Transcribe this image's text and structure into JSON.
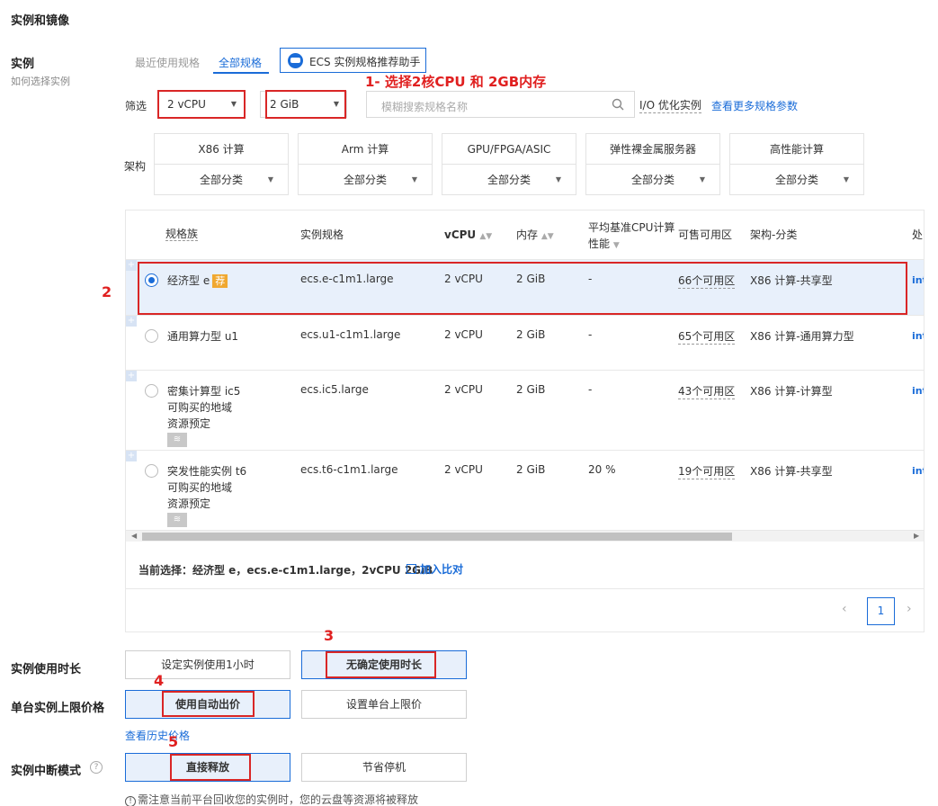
{
  "section_title": "实例和镜像",
  "instance": {
    "label": "实例",
    "help_link": "如何选择实例",
    "tabs": [
      "最近使用规格",
      "全部规格"
    ],
    "assistant_button": "ECS 实例规格推荐助手",
    "annotation_1": "1- 选择2核CPU 和 2GB内存",
    "filter_label": "筛选",
    "vcpu_select": "2 vCPU",
    "mem_select": "2 GiB",
    "search_placeholder": "模糊搜索规格名称",
    "io_optimized": "I/O 优化实例",
    "more_params": "查看更多规格参数",
    "arch_label": "架构",
    "arch_options": [
      {
        "name": "X86 计算",
        "value": "全部分类"
      },
      {
        "name": "Arm 计算",
        "value": "全部分类"
      },
      {
        "name": "GPU/FPGA/ASIC",
        "value": "全部分类"
      },
      {
        "name": "弹性裸金属服务器",
        "value": "全部分类"
      },
      {
        "name": "高性能计算",
        "value": "全部分类"
      }
    ]
  },
  "table": {
    "headers": [
      "规格族",
      "实例规格",
      "vCPU",
      "内存",
      "平均基准CPU计算性能",
      "可售可用区",
      "架构-分类",
      "处"
    ],
    "rows": [
      {
        "family": "经济型 e",
        "tag": "荐",
        "spec": "ecs.e-c1m1.large",
        "vcpu": "2 vCPU",
        "mem": "2 GiB",
        "perf": "-",
        "zones": "66个可用区",
        "arch": "X86 计算-共享型",
        "proc": "intel",
        "selected": true
      },
      {
        "family": "通用算力型 u1",
        "spec": "ecs.u1-c1m1.large",
        "vcpu": "2 vCPU",
        "mem": "2 GiB",
        "perf": "-",
        "zones": "65个可用区",
        "arch": "X86 计算-通用算力型",
        "proc": "intel"
      },
      {
        "family": "密集计算型 ic5",
        "link1": "可购买的地域",
        "link2": "资源预定",
        "spec": "ecs.ic5.large",
        "vcpu": "2 vCPU",
        "mem": "2 GiB",
        "perf": "-",
        "zones": "43个可用区",
        "arch": "X86 计算-计算型",
        "proc": "intel"
      },
      {
        "family": "突发性能实例 t6",
        "link1": "可购买的地域",
        "link2": "资源预定",
        "spec": "ecs.t6-c1m1.large",
        "vcpu": "2 vCPU",
        "mem": "2 GiB",
        "perf": "20 %",
        "zones": "19个可用区",
        "arch": "X86 计算-共享型",
        "proc": "intel"
      }
    ],
    "current_selection": "当前选择：经济型 e，ecs.e-c1m1.large，2vCPU 2GiB",
    "compare": "加入比对",
    "page": "1"
  },
  "annotations": {
    "a2": "2",
    "a3": "3",
    "a4": "4",
    "a5": "5"
  },
  "duration": {
    "label": "实例使用时长",
    "opt1": "设定实例使用1小时",
    "opt2": "无确定使用时长"
  },
  "price": {
    "label": "单台实例上限价格",
    "opt1": "使用自动出价",
    "opt2": "设置单台上限价",
    "history": "查看历史价格"
  },
  "interrupt": {
    "label": "实例中断模式",
    "opt1": "直接释放",
    "opt2": "节省停机",
    "note": "需注意当前平台回收您的实例时，您的云盘等资源将被释放"
  },
  "colors": {
    "accent": "#1a6cd8",
    "annotation_red": "#d92626",
    "selected_bg": "#e8f0fb"
  }
}
